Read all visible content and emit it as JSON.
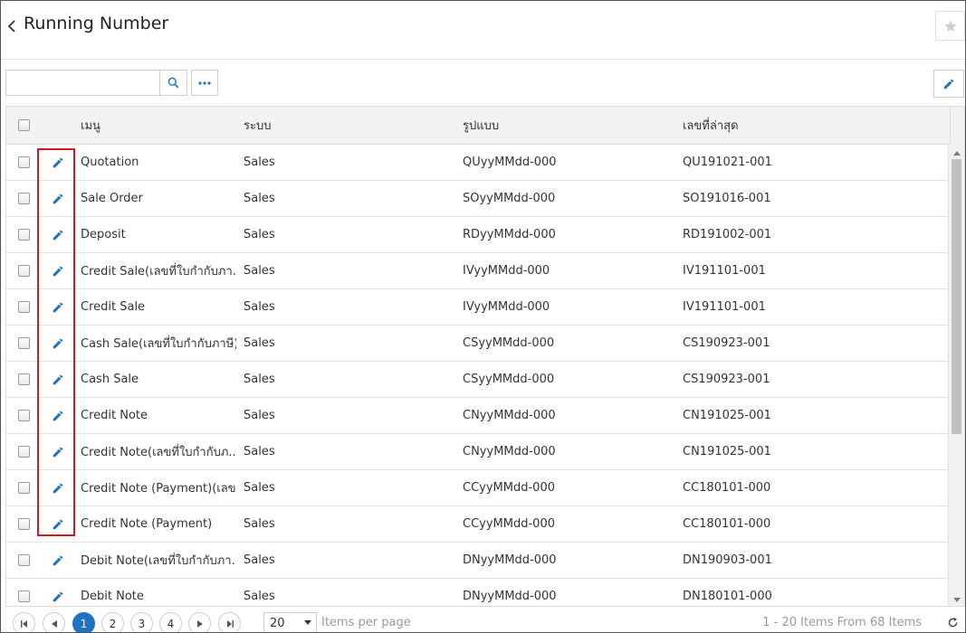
{
  "header": {
    "title": "Running Number",
    "back_icon": "chevron-left-icon",
    "favorite_icon": "star-icon"
  },
  "toolbar": {
    "search": {
      "value": "",
      "placeholder": ""
    },
    "search_icon": "search-icon",
    "more_icon": "ellipsis-icon",
    "edit_icon": "pencil-icon"
  },
  "table": {
    "columns": {
      "menu": "เมนู",
      "system": "ระบบ",
      "format": "รูปแบบ",
      "last_number": "เลขที่ล่าสุด"
    },
    "rows": [
      {
        "menu": "Quotation",
        "system": "Sales",
        "format": "QUyyMMdd-000",
        "last_number": "QU191021-001"
      },
      {
        "menu": "Sale Order",
        "system": "Sales",
        "format": "SOyyMMdd-000",
        "last_number": "SO191016-001"
      },
      {
        "menu": "Deposit",
        "system": "Sales",
        "format": "RDyyMMdd-000",
        "last_number": "RD191002-001"
      },
      {
        "menu": "Credit Sale(เลขที่ใบกำกับภา...",
        "system": "Sales",
        "format": "IVyyMMdd-000",
        "last_number": "IV191101-001"
      },
      {
        "menu": "Credit Sale",
        "system": "Sales",
        "format": "IVyyMMdd-000",
        "last_number": "IV191101-001"
      },
      {
        "menu": "Cash Sale(เลขที่ใบกำกับภาษี)",
        "system": "Sales",
        "format": "CSyyMMdd-000",
        "last_number": "CS190923-001"
      },
      {
        "menu": "Cash Sale",
        "system": "Sales",
        "format": "CSyyMMdd-000",
        "last_number": "CS190923-001"
      },
      {
        "menu": "Credit Note",
        "system": "Sales",
        "format": "CNyyMMdd-000",
        "last_number": "CN191025-001"
      },
      {
        "menu": "Credit Note(เลขที่ใบกำกับภ...",
        "system": "Sales",
        "format": "CNyyMMdd-000",
        "last_number": "CN191025-001"
      },
      {
        "menu": "Credit Note (Payment)(เลข...",
        "system": "Sales",
        "format": "CCyyMMdd-000",
        "last_number": "CC180101-000"
      },
      {
        "menu": "Credit Note (Payment)",
        "system": "Sales",
        "format": "CCyyMMdd-000",
        "last_number": "CC180101-000"
      },
      {
        "menu": "Debit Note(เลขที่ใบกำกับภา...",
        "system": "Sales",
        "format": "DNyyMMdd-000",
        "last_number": "DN190903-001"
      },
      {
        "menu": "Debit Note",
        "system": "Sales",
        "format": "DNyyMMdd-000",
        "last_number": "DN180101-000"
      }
    ]
  },
  "pager": {
    "pages": [
      "1",
      "2",
      "3",
      "4"
    ],
    "current_page": "1",
    "page_size": "20",
    "items_per_page_label": "Items per page",
    "info": "1 - 20 Items From 68 Items"
  },
  "colors": {
    "accent": "#1e74c2",
    "highlight": "#d9151b"
  }
}
